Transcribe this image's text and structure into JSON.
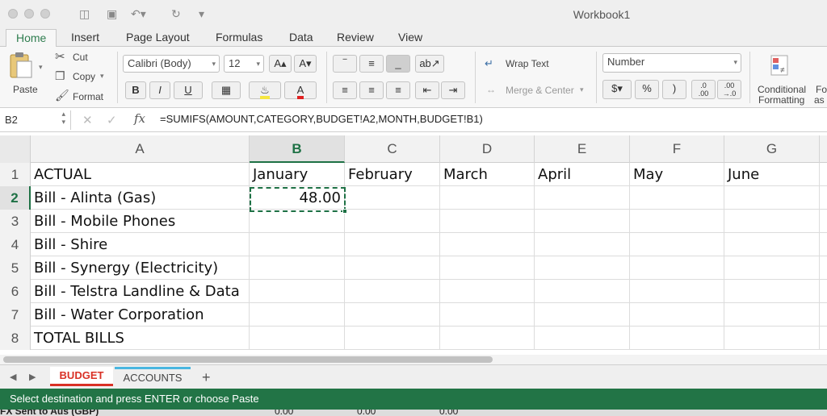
{
  "window": {
    "title": "Workbook1"
  },
  "ribbon_tabs": [
    "Home",
    "Insert",
    "Page Layout",
    "Formulas",
    "Data",
    "Review",
    "View"
  ],
  "ribbon": {
    "paste": "Paste",
    "cut": "Cut",
    "copy": "Copy",
    "format": "Format",
    "font_name": "Calibri (Body)",
    "font_size": "12",
    "bold": "B",
    "italic": "I",
    "underline": "U",
    "wrap_text": "Wrap Text",
    "merge_center": "Merge & Center",
    "number_format": "Number",
    "currency": "$",
    "percent": "%",
    "comma": ")",
    "inc_dec": ".0",
    "inc_dec2": ".00",
    "dec_dec": ".00",
    "dec_dec2": "→.0",
    "conditional": "Conditional",
    "formatting": "Formatting",
    "format_as_a": "Fo",
    "format_as_b": "as"
  },
  "formula_bar": {
    "cell_ref": "B2",
    "fx": "fx",
    "formula": "=SUMIFS(AMOUNT,CATEGORY,BUDGET!A2,MONTH,BUDGET!B1)"
  },
  "columns": [
    "A",
    "B",
    "C",
    "D",
    "E",
    "F",
    "G"
  ],
  "rows": [
    {
      "num": "1",
      "cells": [
        "ACTUAL",
        "January",
        "February",
        "March",
        "April",
        "May",
        "June"
      ]
    },
    {
      "num": "2",
      "cells": [
        "Bill - Alinta (Gas)",
        "48.00",
        "",
        "",
        "",
        "",
        ""
      ]
    },
    {
      "num": "3",
      "cells": [
        "Bill - Mobile Phones",
        "",
        "",
        "",
        "",
        "",
        ""
      ]
    },
    {
      "num": "4",
      "cells": [
        "Bill - Shire",
        "",
        "",
        "",
        "",
        "",
        ""
      ]
    },
    {
      "num": "5",
      "cells": [
        "Bill - Synergy (Electricity)",
        "",
        "",
        "",
        "",
        "",
        ""
      ]
    },
    {
      "num": "6",
      "cells": [
        "Bill - Telstra Landline & Data",
        "",
        "",
        "",
        "",
        "",
        ""
      ]
    },
    {
      "num": "7",
      "cells": [
        "Bill - Water Corporation",
        "",
        "",
        "",
        "",
        "",
        ""
      ]
    },
    {
      "num": "8",
      "cells": [
        "TOTAL BILLS",
        "",
        "",
        "",
        "",
        "",
        ""
      ]
    }
  ],
  "sheets": [
    "BUDGET",
    "ACCOUNTS"
  ],
  "add_sheet": "+",
  "status": "Select destination and press ENTER or choose Paste",
  "background_window": {
    "label": "FX Sent to Aus (GBP)",
    "v1": "0.00",
    "v2": "0.00",
    "v3": "0.00"
  },
  "colors": {
    "excel_green": "#227446",
    "active_tab_red": "#d93025",
    "accounts_tab_blue": "#49b6e0"
  }
}
